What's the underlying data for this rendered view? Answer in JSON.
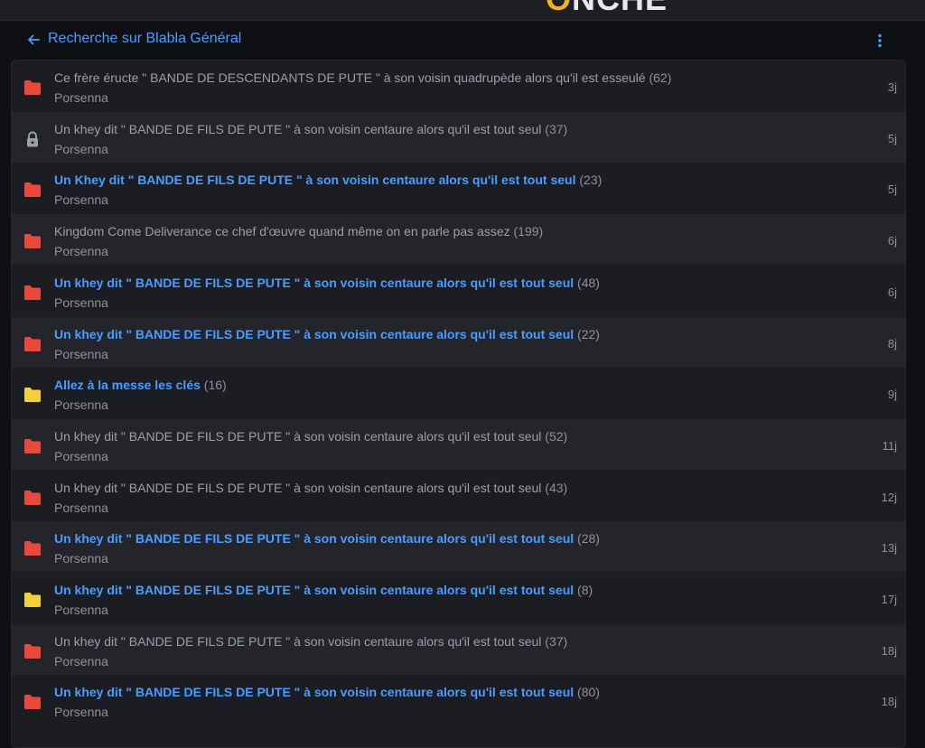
{
  "topbar": {
    "logo_text": "ONCHE"
  },
  "header": {
    "title": "Recherche sur Blabla Général"
  },
  "colors": {
    "accent": "#4a9dff",
    "folder_red": "#e8493a",
    "folder_yellow": "#f4cf3a",
    "lock_gray": "#9aa0a8"
  },
  "topics": [
    {
      "title": "Ce frère éructe \" BANDE DE DESCENDANTS DE PUTE \" à son voisin quadrupède alors qu'il est esseulé",
      "count": "(62)",
      "author": "Porsenna",
      "date": "3j",
      "icon": "folder-red-icon",
      "unread": false
    },
    {
      "title": "Un khey dit \" BANDE DE FILS DE PUTE \" à son voisin centaure alors qu'il est tout seul",
      "count": "(37)",
      "author": "Porsenna",
      "date": "5j",
      "icon": "lock-icon",
      "unread": false
    },
    {
      "title": "Un Khey dit \" BANDE DE FILS DE PUTE \" à son voisin centaure alors qu'il est tout seul",
      "count": "(23)",
      "author": "Porsenna",
      "date": "5j",
      "icon": "folder-red-icon",
      "unread": true
    },
    {
      "title": "Kingdom Come Deliverance ce chef d'œuvre quand même on en parle pas assez",
      "count": "(199)",
      "author": "Porsenna",
      "date": "6j",
      "icon": "folder-red-icon",
      "unread": false
    },
    {
      "title": "Un khey dit \" BANDE DE FILS DE PUTE \" à son voisin centaure alors qu'il est tout seul",
      "count": "(48)",
      "author": "Porsenna",
      "date": "6j",
      "icon": "folder-red-icon",
      "unread": true
    },
    {
      "title": "Un khey dit \" BANDE DE FILS DE PUTE \" à son voisin centaure alors qu'il est tout seul",
      "count": "(22)",
      "author": "Porsenna",
      "date": "8j",
      "icon": "folder-red-icon",
      "unread": true
    },
    {
      "title": "Allez à la messe les clés",
      "count": "(16)",
      "author": "Porsenna",
      "date": "9j",
      "icon": "folder-yellow-icon",
      "unread": true
    },
    {
      "title": "Un khey dit \" BANDE DE FILS DE PUTE \" à son voisin centaure alors qu'il est tout seul",
      "count": "(52)",
      "author": "Porsenna",
      "date": "11j",
      "icon": "folder-red-icon",
      "unread": false
    },
    {
      "title": "Un khey dit \" BANDE DE FILS DE PUTE \" à son voisin centaure alors qu'il est tout seul",
      "count": "(43)",
      "author": "Porsenna",
      "date": "12j",
      "icon": "folder-red-icon",
      "unread": false
    },
    {
      "title": "Un khey dit \" BANDE DE FILS DE PUTE \" à son voisin centaure alors qu'il est tout seul",
      "count": "(28)",
      "author": "Porsenna",
      "date": "13j",
      "icon": "folder-red-icon",
      "unread": true
    },
    {
      "title": "Un khey dit \" BANDE DE FILS DE PUTE \" à son voisin centaure alors qu'il est tout seul",
      "count": "(8)",
      "author": "Porsenna",
      "date": "17j",
      "icon": "folder-yellow-icon",
      "unread": true
    },
    {
      "title": "Un khey dit \" BANDE DE FILS DE PUTE \" à son voisin centaure alors qu'il est tout seul",
      "count": "(37)",
      "author": "Porsenna",
      "date": "18j",
      "icon": "folder-red-icon",
      "unread": false
    },
    {
      "title": "Un khey dit \" BANDE DE FILS DE PUTE \" à son voisin centaure alors qu'il est tout seul",
      "count": "(80)",
      "author": "Porsenna",
      "date": "18j",
      "icon": "folder-red-icon",
      "unread": true
    }
  ]
}
